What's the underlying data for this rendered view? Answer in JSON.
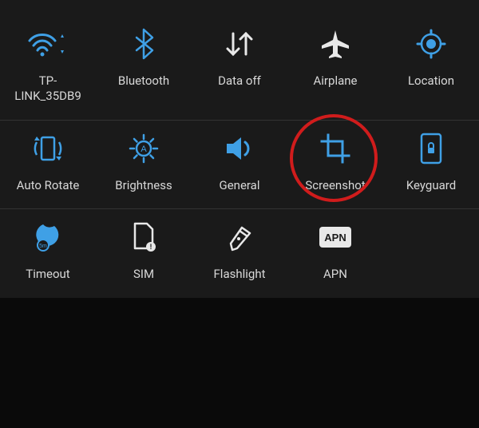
{
  "colors": {
    "accent": "#3fa0e6",
    "text": "#d8d8d8",
    "highlight": "#d01c1c",
    "white": "#e8e8e8"
  },
  "grid": {
    "rows": [
      {
        "tiles": [
          {
            "name": "wifi",
            "icon": "wifi-icon",
            "label": "TP-\nLINK_35DB9"
          },
          {
            "name": "bluetooth",
            "icon": "bluetooth-icon",
            "label": "Bluetooth"
          },
          {
            "name": "data",
            "icon": "data-off-icon",
            "label": "Data off"
          },
          {
            "name": "airplane",
            "icon": "airplane-icon",
            "label": "Airplane"
          },
          {
            "name": "location",
            "icon": "location-icon",
            "label": "Location"
          }
        ]
      },
      {
        "tiles": [
          {
            "name": "auto-rotate",
            "icon": "rotate-icon",
            "label": "Auto Rotate"
          },
          {
            "name": "brightness",
            "icon": "brightness-icon",
            "label": "Brightness"
          },
          {
            "name": "sound",
            "icon": "speaker-icon",
            "label": "General"
          },
          {
            "name": "screenshot",
            "icon": "screenshot-icon",
            "label": "Screenshot",
            "highlighted": true
          },
          {
            "name": "keyguard",
            "icon": "keyguard-icon",
            "label": "Keyguard"
          }
        ]
      },
      {
        "tiles": [
          {
            "name": "timeout",
            "icon": "timeout-icon",
            "label": "Timeout"
          },
          {
            "name": "sim",
            "icon": "sim-icon",
            "label": "SIM"
          },
          {
            "name": "flashlight",
            "icon": "flashlight-icon",
            "label": "Flashlight"
          },
          {
            "name": "apn",
            "icon": "apn-icon",
            "label": "APN"
          }
        ]
      }
    ]
  }
}
